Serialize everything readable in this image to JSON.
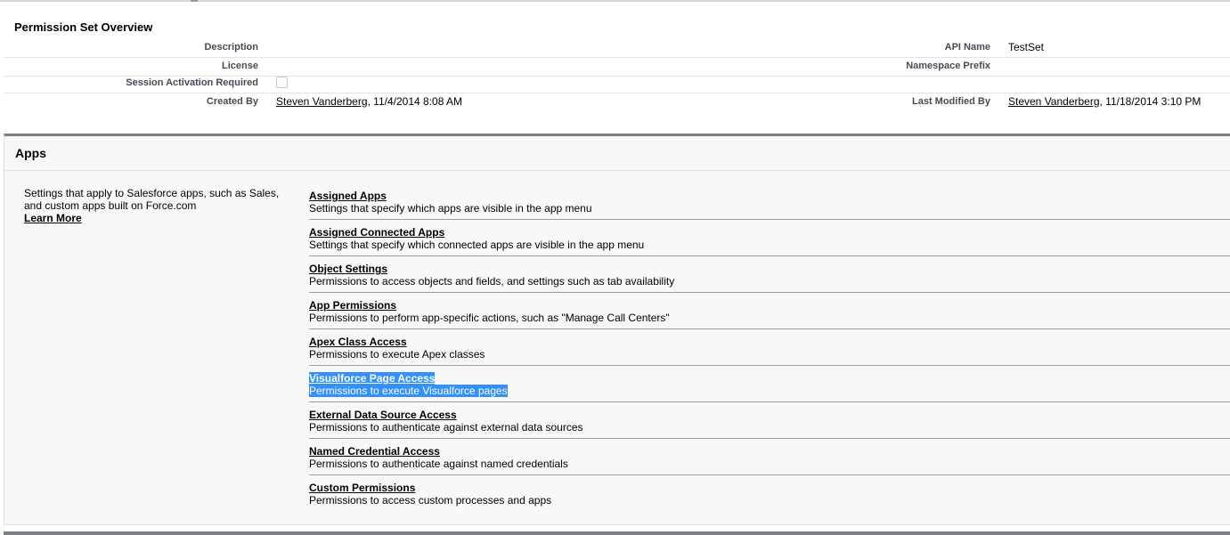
{
  "overview": {
    "title": "Permission Set Overview",
    "description_label": "Description",
    "description_value": "",
    "api_name_label": "API Name",
    "api_name_value": "TestSet",
    "license_label": "License",
    "license_value": "",
    "namespace_prefix_label": "Namespace Prefix",
    "namespace_prefix_value": "",
    "session_activation_label": "Session Activation Required",
    "session_activation_checked": false,
    "created_by_label": "Created By",
    "created_by_user": "Steven Vanderberg",
    "created_by_date": ", 11/4/2014 8:08 AM",
    "last_modified_label": "Last Modified By",
    "last_modified_user": "Steven Vanderberg",
    "last_modified_date": ", 11/18/2014 3:10 PM"
  },
  "apps": {
    "title": "Apps",
    "description_line1": "Settings that apply to Salesforce apps, such as Sales,",
    "description_line2": "and custom apps built on Force.com",
    "learn_more": "Learn More",
    "settings": [
      {
        "title": "Assigned Apps",
        "desc": "Settings that specify which apps are visible in the app menu"
      },
      {
        "title": "Assigned Connected Apps",
        "desc": "Settings that specify which connected apps are visible in the app menu"
      },
      {
        "title": "Object Settings",
        "desc": "Permissions to access objects and fields, and settings such as tab availability"
      },
      {
        "title": "App Permissions",
        "desc": "Permissions to perform app-specific actions, such as \"Manage Call Centers\""
      },
      {
        "title": "Apex Class Access",
        "desc": "Permissions to execute Apex classes"
      },
      {
        "title": "Visualforce Page Access",
        "desc": "Permissions to execute Visualforce pages"
      },
      {
        "title": "External Data Source Access",
        "desc": "Permissions to authenticate against external data sources"
      },
      {
        "title": "Named Credential Access",
        "desc": "Permissions to authenticate against named credentials"
      },
      {
        "title": "Custom Permissions",
        "desc": "Permissions to access custom processes and apps"
      }
    ],
    "selected_color": "#3390ff"
  }
}
